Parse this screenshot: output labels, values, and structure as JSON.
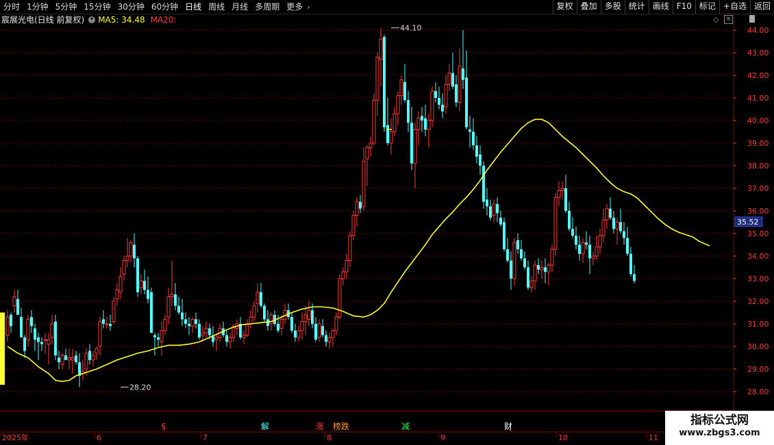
{
  "toolbar": {
    "periods": [
      "分时",
      "1分钟",
      "5分钟",
      "15分钟",
      "30分钟",
      "60分钟",
      "日线",
      "周线",
      "月线",
      "多周期",
      "更多"
    ],
    "active_period": "日线",
    "actions": [
      "复权",
      "叠加",
      "多股",
      "统计",
      "画线",
      "F10",
      "标记",
      "+自选",
      "返回"
    ]
  },
  "title": {
    "stock": "宸展光电(日线 前复权)",
    "ma5": "MA5: 34.48",
    "ma20": "MA20:"
  },
  "colors": {
    "up": "#ff3b3b",
    "down": "#54ffff",
    "ma20": "#ffff33",
    "grid": "#7a0000",
    "axis_text": "#ff3b3b",
    "current_price_bg": "#1e2a7a"
  },
  "watermark": {
    "title": "指标公式网",
    "url": "www.zbgs3.com"
  },
  "chart_data": {
    "type": "candlestick",
    "ylim": [
      27.3,
      44.3
    ],
    "y_ticks": [
      "44.00",
      "43.00",
      "42.00",
      "41.00",
      "40.00",
      "39.00",
      "38.00",
      "37.00",
      "36.00",
      "35.00",
      "34.00",
      "33.00",
      "32.00",
      "31.00",
      "30.00",
      "29.00",
      "28.00"
    ],
    "current_price": "35.52",
    "high_annotation": "44.10",
    "low_annotation": "28.20",
    "x_labels": [
      "2025年",
      "6",
      "7",
      "8",
      "9",
      "10",
      "11"
    ],
    "event_markers": [
      {
        "label": "§",
        "color": "#ff3b3b",
        "index": 46
      },
      {
        "label": "解",
        "color": "#54ffff",
        "index": 75
      },
      {
        "label": "涨",
        "color": "#ff3b3b",
        "index": 91
      },
      {
        "label": "榜跌",
        "color": "#ff9933",
        "index": 96
      },
      {
        "label": "减",
        "color": "#33ff33",
        "index": 116
      },
      {
        "label": "财",
        "color": "#ffffff",
        "index": 146
      }
    ],
    "ohlc": [
      [
        30.5,
        31.6,
        30.2,
        31.3
      ],
      [
        31.4,
        31.5,
        30.6,
        30.9
      ],
      [
        31.8,
        32.5,
        31.5,
        32.2
      ],
      [
        32.1,
        32.5,
        31.7,
        31.4
      ],
      [
        31.3,
        31.7,
        30.4,
        30.4
      ],
      [
        30.4,
        30.5,
        29.5,
        29.8
      ],
      [
        30.3,
        31.4,
        30.0,
        31.2
      ],
      [
        31.3,
        31.6,
        30.6,
        30.9
      ],
      [
        30.8,
        31.0,
        29.8,
        30.3
      ],
      [
        30.4,
        30.6,
        29.4,
        30.2
      ],
      [
        30.2,
        30.4,
        29.8,
        30.1
      ],
      [
        30.3,
        30.6,
        29.7,
        30.3
      ],
      [
        30.1,
        30.6,
        29.2,
        30.3
      ],
      [
        30.4,
        31.4,
        30.1,
        31.0
      ],
      [
        31.1,
        31.4,
        29.4,
        29.6
      ],
      [
        29.5,
        29.8,
        29.0,
        29.3
      ],
      [
        29.2,
        29.7,
        29.0,
        29.6
      ],
      [
        29.6,
        29.9,
        29.4,
        29.4
      ],
      [
        29.4,
        29.9,
        29.0,
        29.5
      ],
      [
        29.4,
        29.9,
        28.8,
        29.5
      ],
      [
        29.6,
        29.8,
        29.2,
        29.3
      ],
      [
        29.3,
        29.7,
        28.2,
        28.7
      ],
      [
        28.8,
        29.4,
        28.5,
        28.9
      ],
      [
        29.0,
        29.9,
        28.7,
        29.7
      ],
      [
        29.8,
        30.1,
        29.2,
        29.4
      ],
      [
        29.4,
        29.8,
        29.1,
        29.6
      ],
      [
        29.7,
        30.0,
        29.4,
        29.9
      ],
      [
        30.0,
        31.3,
        29.6,
        31.1
      ],
      [
        31.2,
        31.6,
        30.8,
        31.0
      ],
      [
        31.0,
        31.3,
        30.8,
        31.0
      ],
      [
        31.0,
        31.4,
        30.7,
        30.9
      ],
      [
        31.1,
        32.2,
        31.0,
        32.0
      ],
      [
        32.1,
        32.8,
        31.8,
        32.5
      ],
      [
        32.4,
        33.5,
        32.1,
        33.1
      ],
      [
        33.2,
        34.0,
        32.9,
        33.8
      ],
      [
        33.8,
        34.8,
        33.5,
        34.0
      ],
      [
        34.0,
        34.7,
        33.7,
        34.6
      ],
      [
        34.5,
        35.0,
        33.5,
        33.9
      ],
      [
        33.9,
        34.0,
        32.2,
        32.4
      ],
      [
        32.6,
        33.2,
        32.3,
        32.9
      ],
      [
        32.9,
        33.4,
        32.3,
        32.5
      ],
      [
        32.5,
        33.1,
        31.9,
        32.1
      ],
      [
        32.4,
        32.6,
        30.6,
        30.6
      ],
      [
        30.5,
        30.6,
        29.6,
        30.4
      ],
      [
        30.4,
        30.6,
        30.0,
        30.3
      ],
      [
        30.2,
        31.1,
        29.6,
        30.7
      ],
      [
        30.7,
        31.4,
        30.5,
        31.2
      ],
      [
        31.3,
        32.6,
        31.0,
        32.2
      ],
      [
        32.2,
        33.8,
        31.8,
        32.3
      ],
      [
        32.3,
        32.8,
        31.6,
        31.8
      ],
      [
        31.8,
        32.2,
        31.4,
        31.5
      ],
      [
        31.5,
        32.1,
        30.9,
        31.2
      ],
      [
        31.2,
        31.5,
        30.8,
        31.0
      ],
      [
        31.0,
        31.3,
        30.5,
        30.9
      ],
      [
        30.9,
        31.3,
        30.6,
        31.2
      ],
      [
        31.2,
        31.5,
        30.8,
        31.0
      ],
      [
        31.0,
        31.2,
        30.3,
        30.4
      ],
      [
        30.5,
        30.9,
        30.2,
        30.6
      ],
      [
        30.6,
        31.1,
        30.4,
        30.8
      ],
      [
        30.8,
        31.0,
        30.3,
        30.5
      ],
      [
        30.5,
        30.9,
        30.0,
        30.2
      ],
      [
        30.3,
        30.6,
        29.8,
        30.4
      ],
      [
        30.4,
        31.0,
        30.2,
        30.8
      ],
      [
        30.8,
        31.1,
        30.4,
        30.5
      ],
      [
        30.5,
        30.7,
        30.0,
        30.2
      ],
      [
        30.2,
        30.6,
        29.9,
        30.4
      ],
      [
        30.4,
        31.0,
        30.2,
        30.9
      ],
      [
        30.8,
        31.2,
        30.5,
        31.0
      ],
      [
        31.0,
        31.3,
        30.3,
        30.4
      ],
      [
        30.4,
        30.7,
        30.1,
        30.5
      ],
      [
        30.5,
        31.2,
        30.4,
        31.0
      ],
      [
        31.0,
        31.6,
        30.8,
        31.3
      ],
      [
        31.3,
        32.0,
        31.1,
        31.8
      ],
      [
        31.9,
        32.8,
        31.5,
        32.4
      ],
      [
        32.4,
        32.8,
        31.7,
        31.8
      ],
      [
        31.8,
        31.9,
        31.1,
        31.2
      ],
      [
        31.2,
        31.6,
        30.7,
        30.9
      ],
      [
        31.0,
        31.5,
        30.7,
        31.4
      ],
      [
        31.4,
        31.6,
        30.9,
        31.0
      ],
      [
        31.0,
        31.4,
        30.6,
        30.7
      ],
      [
        30.8,
        31.4,
        30.5,
        31.2
      ],
      [
        31.2,
        31.9,
        31.0,
        31.6
      ],
      [
        31.6,
        31.9,
        31.2,
        31.3
      ],
      [
        31.3,
        31.5,
        30.6,
        30.7
      ],
      [
        30.7,
        31.0,
        30.2,
        30.4
      ],
      [
        30.4,
        30.9,
        30.2,
        30.7
      ],
      [
        30.7,
        31.5,
        30.3,
        31.1
      ],
      [
        31.1,
        31.8,
        30.5,
        31.4
      ],
      [
        31.2,
        32.0,
        30.9,
        31.6
      ],
      [
        31.6,
        31.9,
        30.8,
        31.0
      ],
      [
        31.0,
        31.3,
        30.2,
        30.3
      ],
      [
        30.4,
        31.2,
        30.2,
        31.0
      ],
      [
        30.9,
        31.2,
        30.4,
        30.5
      ],
      [
        30.5,
        30.7,
        30.0,
        30.2
      ],
      [
        30.2,
        30.6,
        29.9,
        30.4
      ],
      [
        30.4,
        30.8,
        30.0,
        30.7
      ],
      [
        30.7,
        31.5,
        30.5,
        31.3
      ],
      [
        31.3,
        33.2,
        31.2,
        33.0
      ],
      [
        33.0,
        33.5,
        32.7,
        33.3
      ],
      [
        33.3,
        34.1,
        33.0,
        33.8
      ],
      [
        33.8,
        35.1,
        33.5,
        34.9
      ],
      [
        34.9,
        36.0,
        34.7,
        35.8
      ],
      [
        35.8,
        36.6,
        35.3,
        36.4
      ],
      [
        36.4,
        36.7,
        35.9,
        36.1
      ],
      [
        36.2,
        38.8,
        36.0,
        38.2
      ],
      [
        38.3,
        38.9,
        37.1,
        38.8
      ],
      [
        38.8,
        39.3,
        38.4,
        39.0
      ],
      [
        39.0,
        41.2,
        38.9,
        40.9
      ],
      [
        40.9,
        43.0,
        40.2,
        42.8
      ],
      [
        42.7,
        44.1,
        41.5,
        43.6
      ],
      [
        43.7,
        43.8,
        39.5,
        39.7
      ],
      [
        39.8,
        41.0,
        38.9,
        39.0
      ],
      [
        39.0,
        40.1,
        38.5,
        39.5
      ],
      [
        39.5,
        40.6,
        39.3,
        40.3
      ],
      [
        40.3,
        41.3,
        39.8,
        41.1
      ],
      [
        41.1,
        42.0,
        40.7,
        41.8
      ],
      [
        41.7,
        42.5,
        40.8,
        40.9
      ],
      [
        40.9,
        41.3,
        39.5,
        39.9
      ],
      [
        39.9,
        40.6,
        37.8,
        38.1
      ],
      [
        38.1,
        39.9,
        37.0,
        39.6
      ],
      [
        39.6,
        40.4,
        38.9,
        40.1
      ],
      [
        40.2,
        40.6,
        39.5,
        40.0
      ],
      [
        40.1,
        40.7,
        39.3,
        39.6
      ],
      [
        39.6,
        40.3,
        38.8,
        40.0
      ],
      [
        40.0,
        41.5,
        39.7,
        41.3
      ],
      [
        41.3,
        41.7,
        40.8,
        41.0
      ],
      [
        41.0,
        41.5,
        40.5,
        40.7
      ],
      [
        40.7,
        41.2,
        40.1,
        40.4
      ],
      [
        40.6,
        42.0,
        40.3,
        41.6
      ],
      [
        41.6,
        42.5,
        41.3,
        42.1
      ],
      [
        42.1,
        43.0,
        41.4,
        41.5
      ],
      [
        41.6,
        42.0,
        40.6,
        40.8
      ],
      [
        40.8,
        43.2,
        40.4,
        42.4
      ],
      [
        42.3,
        44.0,
        41.4,
        41.8
      ],
      [
        41.9,
        43.1,
        39.6,
        39.7
      ],
      [
        39.6,
        40.2,
        38.8,
        39.5
      ],
      [
        39.5,
        40.1,
        38.7,
        38.9
      ],
      [
        38.9,
        39.3,
        38.1,
        38.4
      ],
      [
        38.5,
        38.9,
        37.6,
        38.0
      ],
      [
        38.0,
        38.2,
        36.1,
        36.4
      ],
      [
        36.5,
        37.0,
        35.8,
        36.2
      ],
      [
        36.2,
        36.5,
        35.6,
        35.7
      ],
      [
        35.8,
        36.5,
        35.5,
        36.3
      ],
      [
        36.3,
        36.6,
        35.5,
        35.9
      ],
      [
        35.7,
        36.0,
        35.3,
        35.4
      ],
      [
        35.5,
        35.7,
        34.2,
        34.3
      ],
      [
        34.3,
        34.8,
        33.7,
        33.8
      ],
      [
        33.8,
        34.2,
        32.5,
        33.0
      ],
      [
        33.0,
        34.8,
        32.7,
        34.6
      ],
      [
        34.7,
        35.0,
        34.1,
        34.3
      ],
      [
        34.3,
        34.7,
        33.8,
        33.9
      ],
      [
        33.9,
        34.2,
        33.4,
        33.5
      ],
      [
        33.5,
        33.8,
        32.5,
        32.6
      ],
      [
        32.6,
        33.1,
        32.4,
        32.9
      ],
      [
        32.9,
        33.8,
        32.5,
        33.6
      ],
      [
        33.6,
        33.9,
        33.2,
        33.4
      ],
      [
        33.4,
        33.8,
        33.0,
        33.5
      ],
      [
        33.5,
        33.9,
        32.8,
        33.3
      ],
      [
        33.3,
        33.7,
        32.7,
        33.6
      ],
      [
        33.6,
        34.5,
        33.3,
        34.3
      ],
      [
        34.3,
        36.8,
        34.0,
        36.6
      ],
      [
        36.6,
        37.3,
        36.2,
        36.9
      ],
      [
        36.9,
        37.3,
        36.5,
        37.0
      ],
      [
        37.0,
        37.6,
        35.9,
        36.0
      ],
      [
        36.0,
        36.4,
        35.1,
        35.2
      ],
      [
        35.2,
        35.7,
        34.8,
        34.9
      ],
      [
        34.9,
        35.3,
        34.3,
        34.5
      ],
      [
        34.5,
        34.9,
        33.8,
        34.1
      ],
      [
        34.1,
        34.8,
        33.7,
        34.6
      ],
      [
        34.6,
        35.1,
        34.3,
        34.5
      ],
      [
        34.5,
        34.9,
        33.2,
        33.9
      ],
      [
        33.9,
        34.2,
        33.6,
        34.0
      ],
      [
        34.0,
        34.9,
        33.8,
        34.4
      ],
      [
        34.4,
        35.2,
        34.1,
        34.9
      ],
      [
        34.9,
        36.1,
        34.6,
        35.6
      ],
      [
        35.6,
        36.3,
        35.2,
        36.1
      ],
      [
        36.1,
        36.6,
        35.6,
        35.7
      ],
      [
        35.7,
        36.0,
        35.0,
        35.2
      ],
      [
        35.2,
        35.7,
        34.5,
        35.5
      ],
      [
        35.5,
        36.1,
        35.0,
        35.1
      ],
      [
        35.1,
        35.5,
        34.5,
        34.8
      ],
      [
        34.8,
        35.3,
        34.0,
        34.1
      ],
      [
        34.1,
        34.4,
        33.1,
        33.2
      ],
      [
        33.2,
        33.6,
        32.8,
        32.9
      ]
    ],
    "ma20": [
      [
        0,
        30.0
      ],
      [
        3,
        29.7
      ],
      [
        6,
        29.5
      ],
      [
        9,
        29.1
      ],
      [
        12,
        28.8
      ],
      [
        14,
        28.5
      ],
      [
        16,
        28.45
      ],
      [
        18,
        28.5
      ],
      [
        20,
        28.7
      ],
      [
        23,
        28.85
      ],
      [
        26,
        29.0
      ],
      [
        29,
        29.2
      ],
      [
        32,
        29.4
      ],
      [
        35,
        29.55
      ],
      [
        38,
        29.7
      ],
      [
        41,
        29.8
      ],
      [
        44,
        29.95
      ],
      [
        47,
        30.05
      ],
      [
        50,
        30.05
      ],
      [
        53,
        30.1
      ],
      [
        56,
        30.2
      ],
      [
        59,
        30.4
      ],
      [
        62,
        30.6
      ],
      [
        65,
        30.8
      ],
      [
        68,
        30.95
      ],
      [
        71,
        31.0
      ],
      [
        74,
        31.05
      ],
      [
        77,
        31.1
      ],
      [
        80,
        31.3
      ],
      [
        83,
        31.5
      ],
      [
        86,
        31.65
      ],
      [
        89,
        31.75
      ],
      [
        92,
        31.75
      ],
      [
        95,
        31.7
      ],
      [
        98,
        31.55
      ],
      [
        101,
        31.35
      ],
      [
        104,
        31.3
      ],
      [
        106,
        31.4
      ],
      [
        108,
        31.6
      ],
      [
        110,
        31.9
      ],
      [
        112,
        32.4
      ],
      [
        114,
        32.85
      ],
      [
        116,
        33.3
      ],
      [
        118,
        33.7
      ],
      [
        120,
        34.1
      ],
      [
        122,
        34.5
      ],
      [
        124,
        34.95
      ],
      [
        126,
        35.3
      ],
      [
        128,
        35.65
      ],
      [
        130,
        35.95
      ],
      [
        132,
        36.3
      ],
      [
        134,
        36.6
      ],
      [
        136,
        36.95
      ],
      [
        138,
        37.35
      ],
      [
        140,
        37.8
      ],
      [
        142,
        38.2
      ],
      [
        144,
        38.6
      ],
      [
        146,
        38.95
      ],
      [
        148,
        39.3
      ],
      [
        150,
        39.65
      ],
      [
        152,
        39.9
      ],
      [
        154,
        40.05
      ],
      [
        156,
        40.05
      ],
      [
        158,
        39.9
      ],
      [
        160,
        39.6
      ],
      [
        162,
        39.3
      ],
      [
        164,
        39.05
      ],
      [
        166,
        38.8
      ],
      [
        168,
        38.5
      ],
      [
        170,
        38.2
      ],
      [
        172,
        37.9
      ],
      [
        174,
        37.55
      ],
      [
        176,
        37.25
      ],
      [
        178,
        37.0
      ],
      [
        180,
        36.85
      ],
      [
        182,
        36.75
      ],
      [
        184,
        36.55
      ],
      [
        186,
        36.25
      ],
      [
        188,
        35.95
      ],
      [
        190,
        35.65
      ],
      [
        192,
        35.4
      ],
      [
        194,
        35.2
      ],
      [
        196,
        35.05
      ],
      [
        198,
        34.95
      ],
      [
        200,
        34.85
      ],
      [
        202,
        34.65
      ],
      [
        205,
        34.45
      ]
    ]
  }
}
